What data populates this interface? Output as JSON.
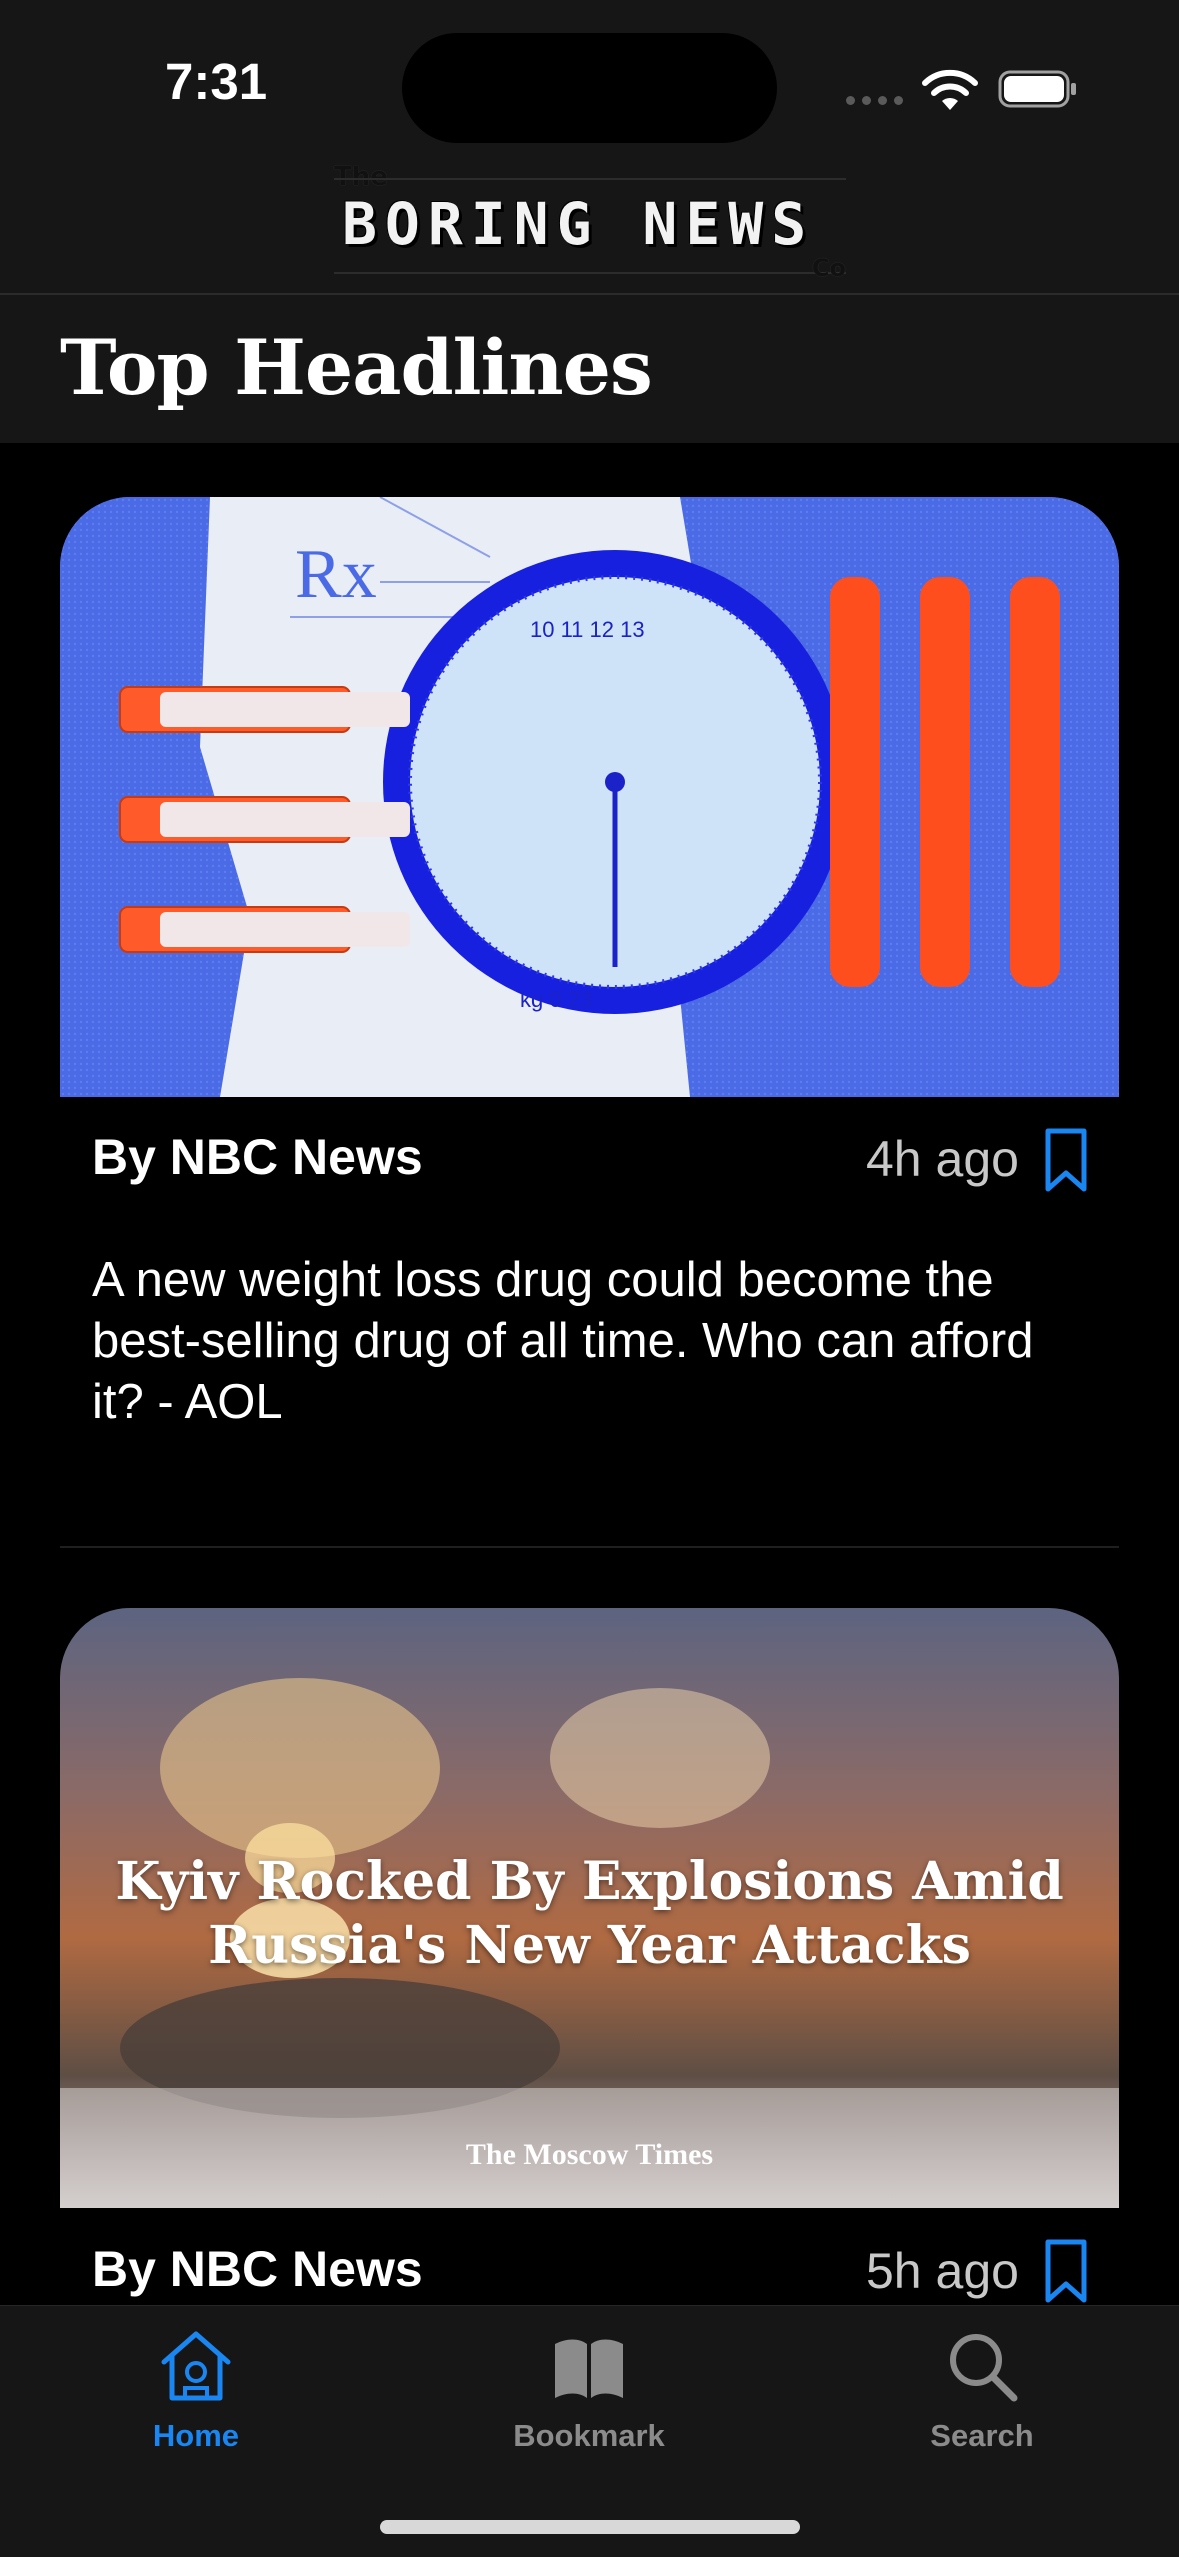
{
  "status": {
    "time": "7:31"
  },
  "logo": {
    "the": "The",
    "title": "BORING NEWS",
    "co": "Co"
  },
  "page": {
    "title": "Top Headlines"
  },
  "articles": [
    {
      "byline": "By NBC News",
      "time_ago": "4h ago",
      "headline": "A new weight loss drug could become the best-selling drug of all time. Who can afford it? - AOL"
    },
    {
      "byline": "By NBC News",
      "time_ago": "5h ago",
      "image_title": "Kyiv Rocked By Explosions Amid Russia's New Year Attacks",
      "image_source": "The Moscow Times"
    }
  ],
  "tabs": [
    {
      "label": "Home",
      "icon": "home-icon",
      "active": true
    },
    {
      "label": "Bookmark",
      "icon": "book-icon",
      "active": false
    },
    {
      "label": "Search",
      "icon": "search-icon",
      "active": false
    }
  ],
  "colors": {
    "accent": "#1a86f2",
    "bar_bg": "#161616",
    "background": "#000000"
  }
}
